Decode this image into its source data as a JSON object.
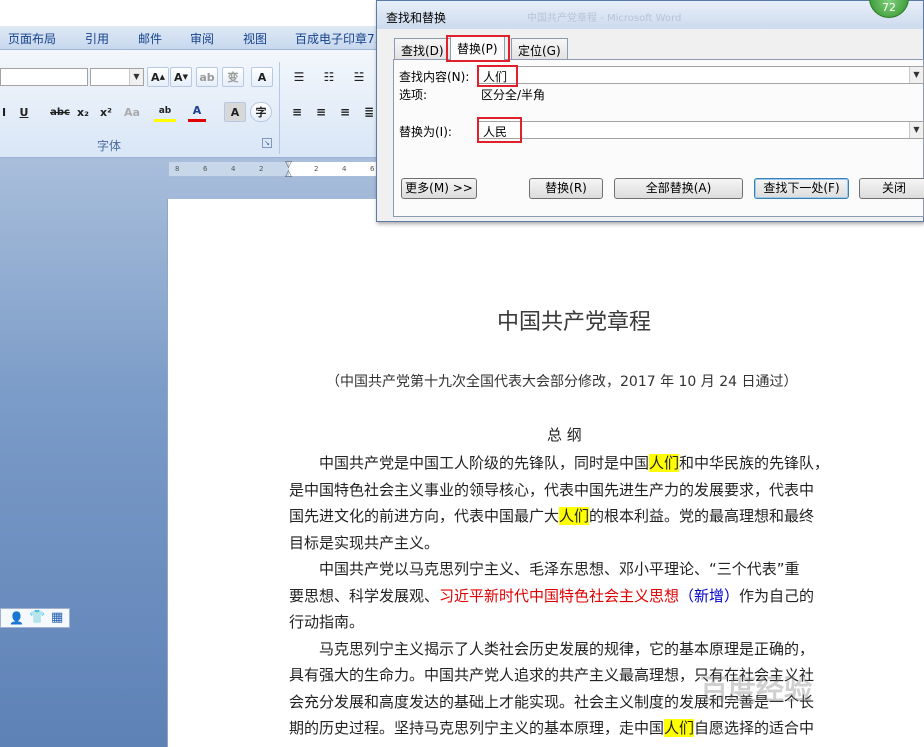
{
  "ribbon": {
    "tabs": [
      "页面布局",
      "引用",
      "邮件",
      "审阅",
      "视图",
      "百成电子印章7."
    ],
    "font_group_label": "字体"
  },
  "ruler": {
    "ticks": [
      "8",
      "6",
      "4",
      "2",
      "2",
      "4",
      "6"
    ]
  },
  "dialog": {
    "title": "查找和替换",
    "title_ghost": "中国共产党章程 - Microsoft Word",
    "tabs": [
      {
        "label": "查找(D)"
      },
      {
        "label": "替换(P)"
      },
      {
        "label": "定位(G)"
      }
    ],
    "find_label": "查找内容(N):",
    "find_value": "人们",
    "options_label": "选项:",
    "options_value": "区分全/半角",
    "replace_label": "替换为(I):",
    "replace_value": "人民",
    "buttons": {
      "more": "更多(M) >>",
      "replace": "替换(R)",
      "replace_all": "全部替换(A)",
      "find_next": "查找下一处(F)",
      "close": "关闭"
    }
  },
  "badge": "72",
  "document": {
    "title": "中国共产党章程",
    "subtitle": "（中国共产党第十九次全国代表大会部分修改，2017 年 10 月 24 日通过）",
    "section": "总    纲",
    "lines": [
      {
        "parts": [
          {
            "t": "　　中国共产党是中国工人阶级的先锋队，同时是中国"
          },
          {
            "t": "人们",
            "c": "hl"
          },
          {
            "t": "和中华民族的先锋队，"
          }
        ]
      },
      {
        "parts": [
          {
            "t": "是中国特色社会主义事业的领导核心，代表中国先进生产力的发展要求，代表中"
          }
        ]
      },
      {
        "parts": [
          {
            "t": "国先进文化的前进方向，代表中国最广大"
          },
          {
            "t": "人们",
            "c": "hl"
          },
          {
            "t": "的根本利益。党的最高理想和最终"
          }
        ]
      },
      {
        "parts": [
          {
            "t": "目标是实现共产主义。"
          }
        ]
      },
      {
        "parts": [
          {
            "t": "　　中国共产党以马克思列宁主义、毛泽东思想、邓小平理论、“三个代表”重"
          }
        ]
      },
      {
        "parts": [
          {
            "t": "要思想、科学发展观、"
          },
          {
            "t": "习近平新时代中国特色社会主义思想",
            "c": "red"
          },
          {
            "t": "（新增）",
            "c": "blue"
          },
          {
            "t": "作为自己的"
          }
        ]
      },
      {
        "parts": [
          {
            "t": "行动指南。"
          }
        ]
      },
      {
        "parts": [
          {
            "t": "　　马克思列宁主义揭示了人类社会历史发展的规律，它的基本原理是正确的，"
          }
        ]
      },
      {
        "parts": [
          {
            "t": "具有强大的生命力。中国共产党人追求的共产主义最高理想，只有在社会主义社"
          }
        ]
      },
      {
        "parts": [
          {
            "t": "会充分发展和高度发达的基础上才能实现。社会主义制度的发展和完善是一个长"
          }
        ]
      },
      {
        "parts": [
          {
            "t": "期的历史过程。坚持马克思列宁主义的基本原理，走中国"
          },
          {
            "t": "人们",
            "c": "hl"
          },
          {
            "t": "自愿选择的适合中"
          }
        ]
      }
    ]
  },
  "watermark": "百度经验"
}
